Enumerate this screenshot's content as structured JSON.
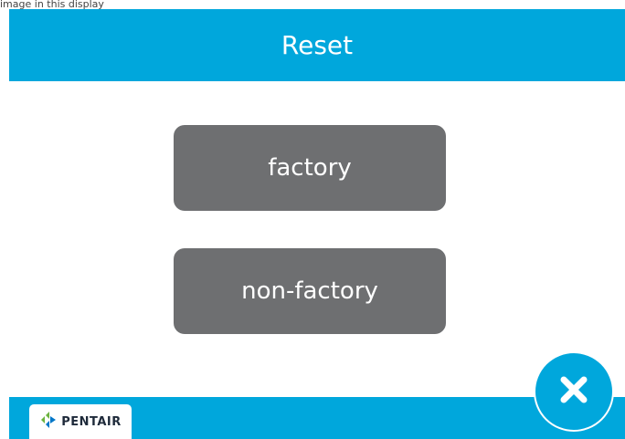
{
  "caption": "image in this display",
  "header": {
    "title": "Reset"
  },
  "buttons": {
    "factory_label": "factory",
    "nonfactory_label": "non-factory"
  },
  "footer": {
    "logo": {
      "icon": "pentair-diamond-icon",
      "text": "PENTAIR"
    }
  },
  "close": {
    "icon": "close-icon"
  },
  "colors": {
    "accent": "#00a7dc",
    "button": "#6e6f71",
    "background": "#ffffff",
    "logo_green": "#6cb33f",
    "logo_blue": "#0077c8"
  }
}
